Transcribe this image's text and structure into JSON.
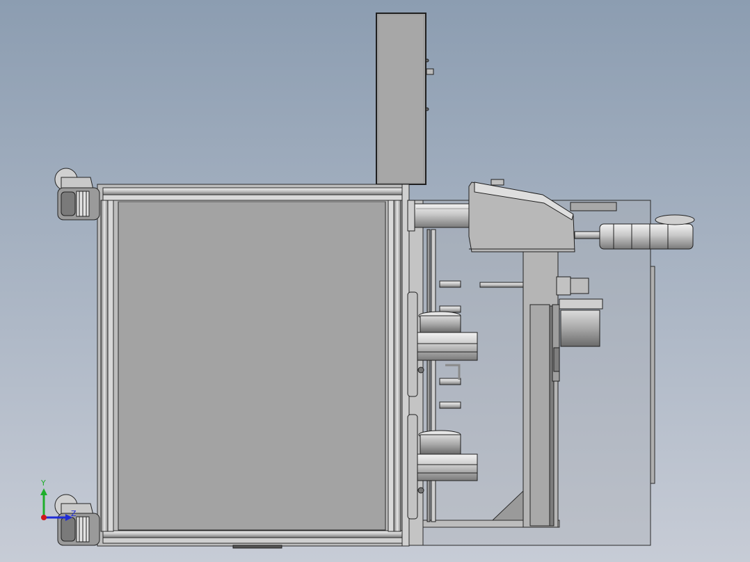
{
  "viewport": {
    "background_top": "#8c9db1",
    "background_bottom": "#c7ccd6",
    "metal_light": "#e8e8e8",
    "metal_mid": "#b4b4b4",
    "metal_dark": "#6e6e6e",
    "panel_fill": "#a3a3a3",
    "outline": "#1f1f1f"
  },
  "triad": {
    "y_label": "Y",
    "z_label": "Z",
    "x_color": "#d0161b",
    "y_color": "#1fae2b",
    "z_color": "#1f2cd6"
  }
}
